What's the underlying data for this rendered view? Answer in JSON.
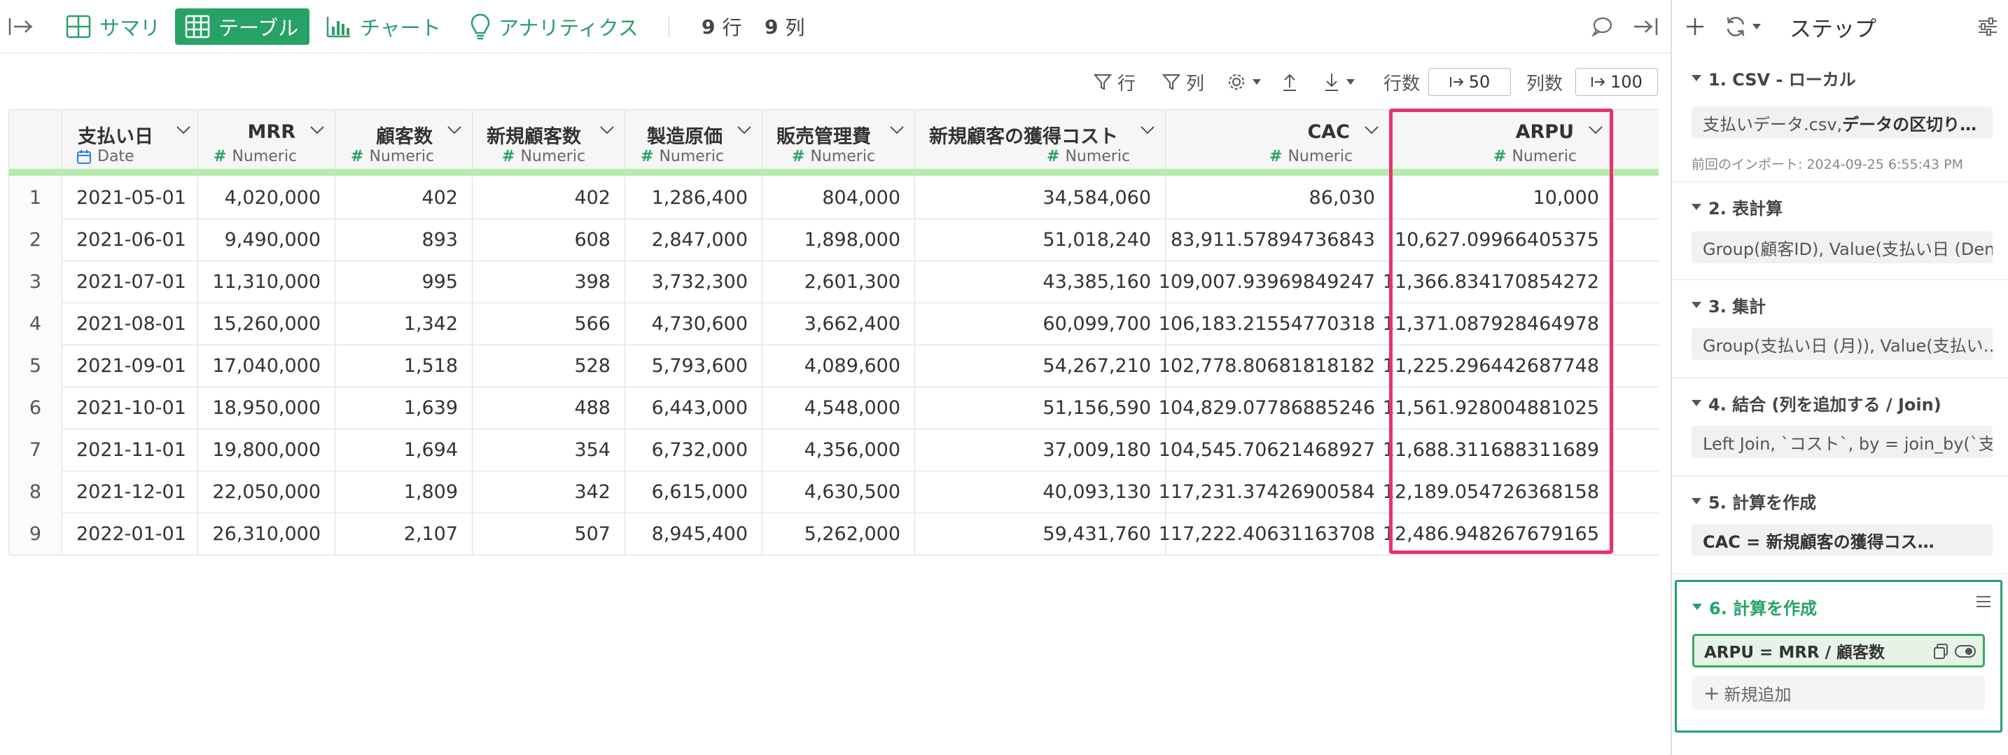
{
  "topbar": {
    "tabs": [
      {
        "label": "サマリ",
        "icon": "grid-icon"
      },
      {
        "label": "テーブル",
        "icon": "table-icon"
      },
      {
        "label": "チャート",
        "icon": "bar-chart-icon"
      },
      {
        "label": "アナリティクス",
        "icon": "lightbulb-icon"
      }
    ],
    "rows_count": "9",
    "rows_unit": "行",
    "cols_count": "9",
    "cols_unit": "列"
  },
  "toolbar": {
    "row_filter": "行",
    "col_filter": "列",
    "rows_label": "行数",
    "rows_value": "50",
    "cols_label": "列数",
    "cols_value": "100"
  },
  "table": {
    "columns": [
      {
        "name": "支払い日",
        "type": "Date"
      },
      {
        "name": "MRR",
        "type": "Numeric"
      },
      {
        "name": "顧客数",
        "type": "Numeric"
      },
      {
        "name": "新規顧客数",
        "type": "Numeric"
      },
      {
        "name": "製造原価",
        "type": "Numeric"
      },
      {
        "name": "販売管理費",
        "type": "Numeric"
      },
      {
        "name": "新規顧客の獲得コスト",
        "type": "Numeric"
      },
      {
        "name": "CAC",
        "type": "Numeric"
      },
      {
        "name": "ARPU",
        "type": "Numeric"
      }
    ],
    "rows": [
      [
        "1",
        "2021-05-01",
        "4,020,000",
        "402",
        "402",
        "1,286,400",
        "804,000",
        "34,584,060",
        "86,030",
        "10,000"
      ],
      [
        "2",
        "2021-06-01",
        "9,490,000",
        "893",
        "608",
        "2,847,000",
        "1,898,000",
        "51,018,240",
        "83,911.57894736843",
        "10,627.09966405375"
      ],
      [
        "3",
        "2021-07-01",
        "11,310,000",
        "995",
        "398",
        "3,732,300",
        "2,601,300",
        "43,385,160",
        "109,007.93969849247",
        "11,366.834170854272"
      ],
      [
        "4",
        "2021-08-01",
        "15,260,000",
        "1,342",
        "566",
        "4,730,600",
        "3,662,400",
        "60,099,700",
        "106,183.21554770318",
        "11,371.087928464978"
      ],
      [
        "5",
        "2021-09-01",
        "17,040,000",
        "1,518",
        "528",
        "5,793,600",
        "4,089,600",
        "54,267,210",
        "102,778.80681818182",
        "11,225.296442687748"
      ],
      [
        "6",
        "2021-10-01",
        "18,950,000",
        "1,639",
        "488",
        "6,443,000",
        "4,548,000",
        "51,156,590",
        "104,829.07786885246",
        "11,561.928004881025"
      ],
      [
        "7",
        "2021-11-01",
        "19,800,000",
        "1,694",
        "354",
        "6,732,000",
        "4,356,000",
        "37,009,180",
        "104,545.70621468927",
        "11,688.311688311689"
      ],
      [
        "8",
        "2021-12-01",
        "22,050,000",
        "1,809",
        "342",
        "6,615,000",
        "4,630,500",
        "40,093,130",
        "117,231.37426900584",
        "12,189.054726368158"
      ],
      [
        "9",
        "2022-01-01",
        "26,310,000",
        "2,107",
        "507",
        "8,945,400",
        "5,262,000",
        "59,431,760",
        "117,222.40631163708",
        "12,486.948267679165"
      ]
    ]
  },
  "side": {
    "title": "ステップ",
    "steps": [
      {
        "title": "1. CSV - ローカル",
        "summary_plain": "支払いデータ.csv, ",
        "summary_bold": "データの区切り…",
        "note": "前回のインポート: 2024-09-25 6:55:43 PM"
      },
      {
        "title": "2. 表計算",
        "summary": "Group(顧客ID), Value(支払い日 (Den…"
      },
      {
        "title": "3. 集計",
        "summary": "Group(支払い日 (月)), Value(支払い…"
      },
      {
        "title": "4. 結合 (列を追加する / Join)",
        "summary": "Left Join, `コスト`, by = join_by(`支…"
      },
      {
        "title": "5. 計算を作成",
        "summary": "CAC = 新規顧客の獲得コス…"
      },
      {
        "title": "6. 計算を作成",
        "formula": "ARPU = MRR / 顧客数",
        "add_label": "新規追加"
      }
    ]
  },
  "colors": {
    "accent": "#27a267",
    "highlight": "#e8336a",
    "type_strip": "#b6ecad"
  }
}
